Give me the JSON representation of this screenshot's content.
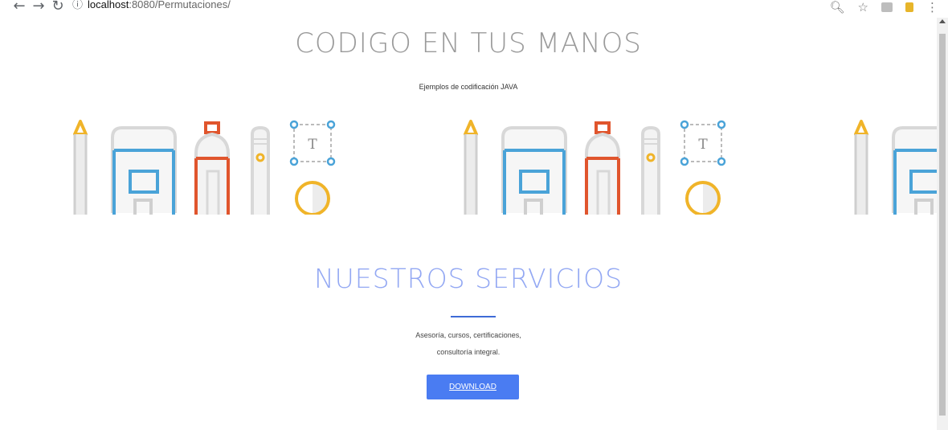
{
  "browser": {
    "url_host": "localhost",
    "url_port": ":8080",
    "url_path": "/Permutaciones/"
  },
  "hero": {
    "title": "CODIGO EN TUS MANOS",
    "subtitle": "Ejemplos de codificación JAVA",
    "illustration_letter": "T"
  },
  "services": {
    "title": "NUESTROS SERVICIOS",
    "desc_line1": "Asesoría, cursos, certificaciones,",
    "desc_line2": "consultoría integral.",
    "button_label": "DOWNLOAD"
  },
  "colors": {
    "accent_blue": "#4a7cf2",
    "heading_gray": "#9a9a9a",
    "services_heading": "#93a8f3",
    "illus_yellow": "#f0b429",
    "illus_blue": "#4aa3d8",
    "illus_red": "#e0552d"
  }
}
